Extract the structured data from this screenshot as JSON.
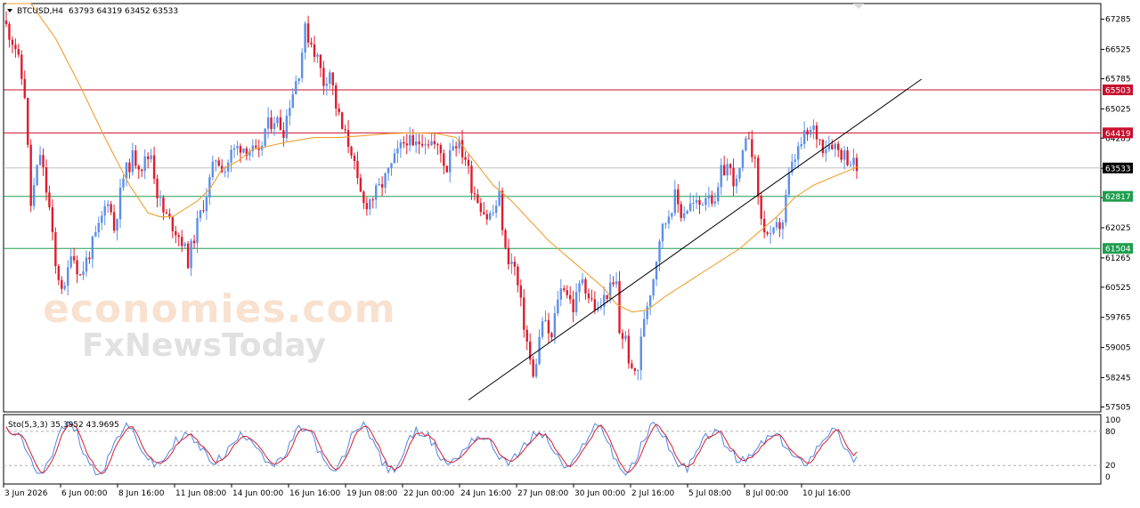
{
  "chart_header": {
    "symbol_timeframe": "BTCUSD,H4",
    "ohlc_values": "63793 64319 63452 63533"
  },
  "indicator_label": "Sto(5,3,3) 35.3952 43.9695",
  "watermark": {
    "line1": "economies.com",
    "line2": "FxNewsToday"
  },
  "colors": {
    "bull_candle": "#5b8fe8",
    "bear_candle": "#e01b2d",
    "ma_line": "#f0a030",
    "resistance_line": "#c8102e",
    "support_line": "#1e9e4e",
    "trend_line": "#000000",
    "stoch_main": "#4f86e6",
    "stoch_signal": "#d91e2e"
  },
  "chart_data": {
    "type": "candlestick",
    "price_ticks": [
      "67285",
      "66525",
      "65785",
      "65025",
      "64285",
      "63525",
      "62785",
      "62025",
      "61265",
      "60525",
      "59765",
      "59005",
      "58245",
      "57505"
    ],
    "date_ticks": [
      "3 Jun 2026",
      "6 Jun 00:00",
      "8 Jun 16:00",
      "11 Jun 08:00",
      "14 Jun 00:00",
      "16 Jun 16:00",
      "19 Jun 08:00",
      "22 Jun 00:00",
      "24 Jun 16:00",
      "27 Jun 08:00",
      "30 Jun 00:00",
      "2 Jul 16:00",
      "5 Jul 08:00",
      "8 Jul 00:00",
      "10 Jul 16:00"
    ],
    "y_range": [
      57380,
      67680
    ],
    "horizontal_levels": [
      {
        "label": "65503",
        "value": 65503,
        "kind": "resistance"
      },
      {
        "label": "64419",
        "value": 64419,
        "kind": "resistance"
      },
      {
        "label": "62817",
        "value": 62817,
        "kind": "support"
      },
      {
        "label": "61504",
        "value": 61504,
        "kind": "support"
      }
    ],
    "current_price": {
      "label": "63533",
      "value": 63533
    },
    "trendline": {
      "from_candle": 150,
      "from_price": 57680,
      "to_candle": 234,
      "to_price": 65100
    },
    "close_path": [
      [
        0,
        67100
      ],
      [
        3,
        66600
      ],
      [
        6,
        65400
      ],
      [
        8,
        62600
      ],
      [
        11,
        63900
      ],
      [
        14,
        62500
      ],
      [
        16,
        61000
      ],
      [
        19,
        60400
      ],
      [
        21,
        61500
      ],
      [
        24,
        60800
      ],
      [
        27,
        61400
      ],
      [
        30,
        62000
      ],
      [
        33,
        62800
      ],
      [
        35,
        62000
      ],
      [
        38,
        63300
      ],
      [
        41,
        63800
      ],
      [
        44,
        63600
      ],
      [
        47,
        63900
      ],
      [
        49,
        62900
      ],
      [
        51,
        62400
      ],
      [
        54,
        62100
      ],
      [
        57,
        61700
      ],
      [
        59,
        61200
      ],
      [
        62,
        62100
      ],
      [
        65,
        62900
      ],
      [
        68,
        63800
      ],
      [
        71,
        63500
      ],
      [
        73,
        63900
      ],
      [
        76,
        64100
      ],
      [
        79,
        64000
      ],
      [
        82,
        63800
      ],
      [
        84,
        64500
      ],
      [
        87,
        64800
      ],
      [
        90,
        64500
      ],
      [
        92,
        65200
      ],
      [
        95,
        66000
      ],
      [
        97,
        67000
      ],
      [
        99,
        66700
      ],
      [
        101,
        66300
      ],
      [
        103,
        65700
      ],
      [
        105,
        66000
      ],
      [
        107,
        65100
      ],
      [
        109,
        64500
      ],
      [
        112,
        64000
      ],
      [
        114,
        63100
      ],
      [
        116,
        62600
      ],
      [
        119,
        62800
      ],
      [
        121,
        63000
      ],
      [
        124,
        63400
      ],
      [
        127,
        63900
      ],
      [
        130,
        64300
      ],
      [
        132,
        64000
      ],
      [
        135,
        64300
      ],
      [
        138,
        64200
      ],
      [
        141,
        63900
      ],
      [
        143,
        63500
      ],
      [
        144,
        64100
      ],
      [
        146,
        64200
      ],
      [
        149,
        63800
      ],
      [
        151,
        63100
      ],
      [
        154,
        62600
      ],
      [
        156,
        62300
      ],
      [
        158,
        62400
      ],
      [
        160,
        62800
      ],
      [
        162,
        61400
      ],
      [
        165,
        61000
      ],
      [
        168,
        59600
      ],
      [
        171,
        58200
      ],
      [
        174,
        59700
      ],
      [
        177,
        59200
      ],
      [
        179,
        60300
      ],
      [
        181,
        60600
      ],
      [
        184,
        60000
      ],
      [
        187,
        60800
      ],
      [
        189,
        60300
      ],
      [
        192,
        59900
      ],
      [
        195,
        60400
      ],
      [
        198,
        60600
      ],
      [
        199,
        59400
      ],
      [
        201,
        59200
      ],
      [
        203,
        58300
      ],
      [
        205,
        58500
      ],
      [
        207,
        59800
      ],
      [
        210,
        60800
      ],
      [
        212,
        61800
      ],
      [
        214,
        62200
      ],
      [
        217,
        62800
      ],
      [
        219,
        62400
      ],
      [
        222,
        62600
      ],
      [
        225,
        62600
      ],
      [
        228,
        63000
      ],
      [
        230,
        62500
      ],
      [
        232,
        63400
      ],
      [
        234,
        63600
      ],
      [
        237,
        63100
      ],
      [
        239,
        63800
      ],
      [
        241,
        64400
      ],
      [
        243,
        63600
      ],
      [
        245,
        62200
      ],
      [
        248,
        61700
      ],
      [
        250,
        62000
      ],
      [
        252,
        62200
      ],
      [
        254,
        63300
      ],
      [
        256,
        63800
      ],
      [
        259,
        64300
      ],
      [
        262,
        64500
      ],
      [
        265,
        64100
      ],
      [
        268,
        64200
      ],
      [
        270,
        64000
      ],
      [
        273,
        63800
      ],
      [
        276,
        63533
      ]
    ],
    "ma_path": [
      [
        0,
        69200
      ],
      [
        8,
        68000
      ],
      [
        16,
        66800
      ],
      [
        24,
        65600
      ],
      [
        32,
        64300
      ],
      [
        40,
        63100
      ],
      [
        46,
        62400
      ],
      [
        50,
        62300
      ],
      [
        54,
        62300
      ],
      [
        58,
        62500
      ],
      [
        62,
        62700
      ],
      [
        66,
        63000
      ],
      [
        70,
        63500
      ],
      [
        75,
        63700
      ],
      [
        80,
        64000
      ],
      [
        86,
        64100
      ],
      [
        92,
        64200
      ],
      [
        100,
        64300
      ],
      [
        108,
        64300
      ],
      [
        116,
        64350
      ],
      [
        124,
        64400
      ],
      [
        132,
        64420
      ],
      [
        140,
        64400
      ],
      [
        146,
        64300
      ],
      [
        152,
        63700
      ],
      [
        158,
        63100
      ],
      [
        164,
        62700
      ],
      [
        170,
        62200
      ],
      [
        176,
        61700
      ],
      [
        182,
        61300
      ],
      [
        188,
        60900
      ],
      [
        194,
        60500
      ],
      [
        198,
        60100
      ],
      [
        203,
        59900
      ],
      [
        208,
        59950
      ],
      [
        214,
        60300
      ],
      [
        220,
        60600
      ],
      [
        226,
        60900
      ],
      [
        232,
        61200
      ],
      [
        238,
        61500
      ],
      [
        244,
        61900
      ],
      [
        250,
        62300
      ],
      [
        256,
        62800
      ],
      [
        262,
        63100
      ],
      [
        268,
        63300
      ],
      [
        276,
        63550
      ]
    ],
    "stoch_levels": {
      "upper": 80,
      "lower": 20
    },
    "stoch_axis_ticks": [
      "100",
      "80",
      "20",
      "0"
    ],
    "stoch_current": {
      "main": 35.3952,
      "signal": 43.9695
    }
  }
}
